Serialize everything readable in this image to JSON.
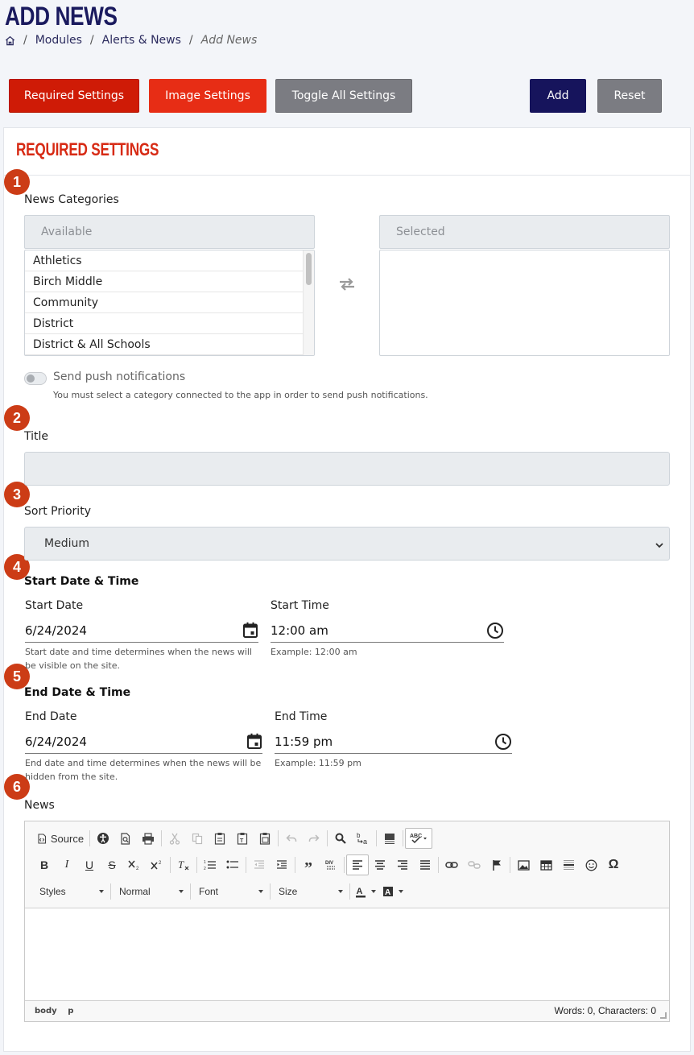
{
  "page": {
    "title": "ADD NEWS",
    "breadcrumb": [
      "Modules",
      "Alerts & News",
      "Add News"
    ]
  },
  "actions": {
    "required_settings": "Required Settings",
    "image_settings": "Image Settings",
    "toggle_all": "Toggle All Settings",
    "add": "Add",
    "reset": "Reset"
  },
  "colors": {
    "title_navy": "#1a1a5e",
    "accent_red": "#cf1b06",
    "step_badge": "#cc3c16",
    "add_button": "#16145c"
  },
  "section": {
    "title": "REQUIRED SETTINGS"
  },
  "steps": [
    "1",
    "2",
    "3",
    "4",
    "5",
    "6"
  ],
  "categories": {
    "label": "News Categories",
    "available_placeholder": "Available",
    "selected_placeholder": "Selected",
    "available_items": [
      "Athletics",
      "Birch Middle",
      "Community",
      "District",
      "District & All Schools"
    ],
    "selected_items": [],
    "transfer_icon": "swap-arrows-icon"
  },
  "push": {
    "label": "Send push notifications",
    "enabled": false,
    "hint": "You must select a category connected to the app in order to send push notifications."
  },
  "title_field": {
    "label": "Title",
    "value": ""
  },
  "sort_priority": {
    "label": "Sort Priority",
    "value": "Medium"
  },
  "start": {
    "heading": "Start Date & Time",
    "date_label": "Start Date",
    "date_value": "6/24/2024",
    "time_label": "Start Time",
    "time_value": "12:00 am",
    "date_hint": "Start date and time determines when the news will be visible on the site.",
    "time_hint": "Example: 12:00 am"
  },
  "end": {
    "heading": "End Date & Time",
    "date_label": "End Date",
    "date_value": "6/24/2024",
    "time_label": "End Time",
    "time_value": "11:59 pm",
    "date_hint": "End date and time determines when the news will be hidden from the site.",
    "time_hint": "Example: 11:59 pm"
  },
  "editor": {
    "label": "News",
    "source_label": "Source",
    "styles_label": "Styles",
    "format_label": "Normal",
    "font_label": "Font",
    "size_label": "Size",
    "path": [
      "body",
      "p"
    ],
    "word_count": "Words: 0, Characters: 0"
  }
}
